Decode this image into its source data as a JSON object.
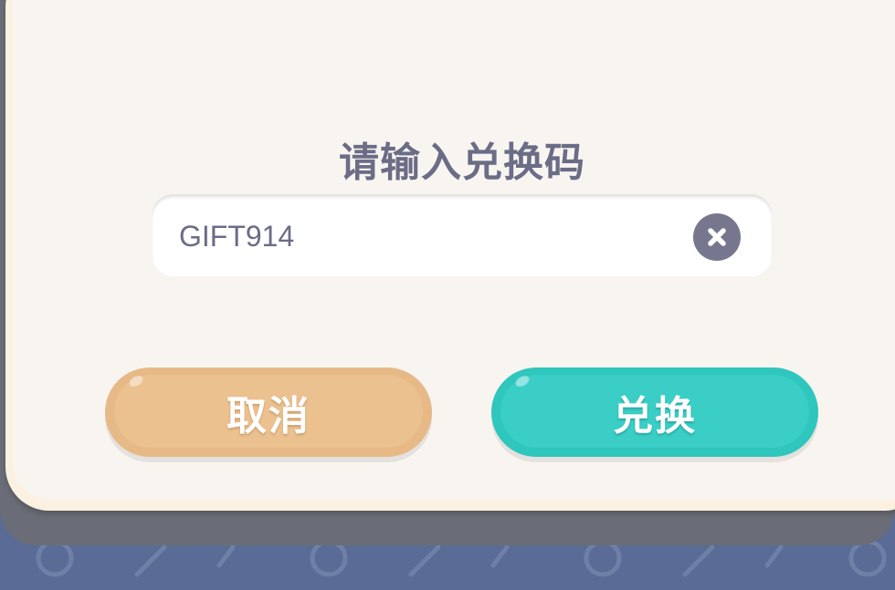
{
  "dialog": {
    "title": "请输入兑换码",
    "input": {
      "value": "GIFT914"
    },
    "buttons": {
      "cancel_label": "取消",
      "confirm_label": "兑换"
    }
  },
  "colors": {
    "background": "#5a6c95",
    "dialog_bg": "#f8f5f1",
    "dialog_border": "#fbf1e0",
    "title_text": "#6b6c86",
    "cancel_button": "#e7b987",
    "confirm_button": "#2fc6bd",
    "clear_icon": "#76778f"
  },
  "icons": {
    "clear": "close-circle-icon"
  }
}
